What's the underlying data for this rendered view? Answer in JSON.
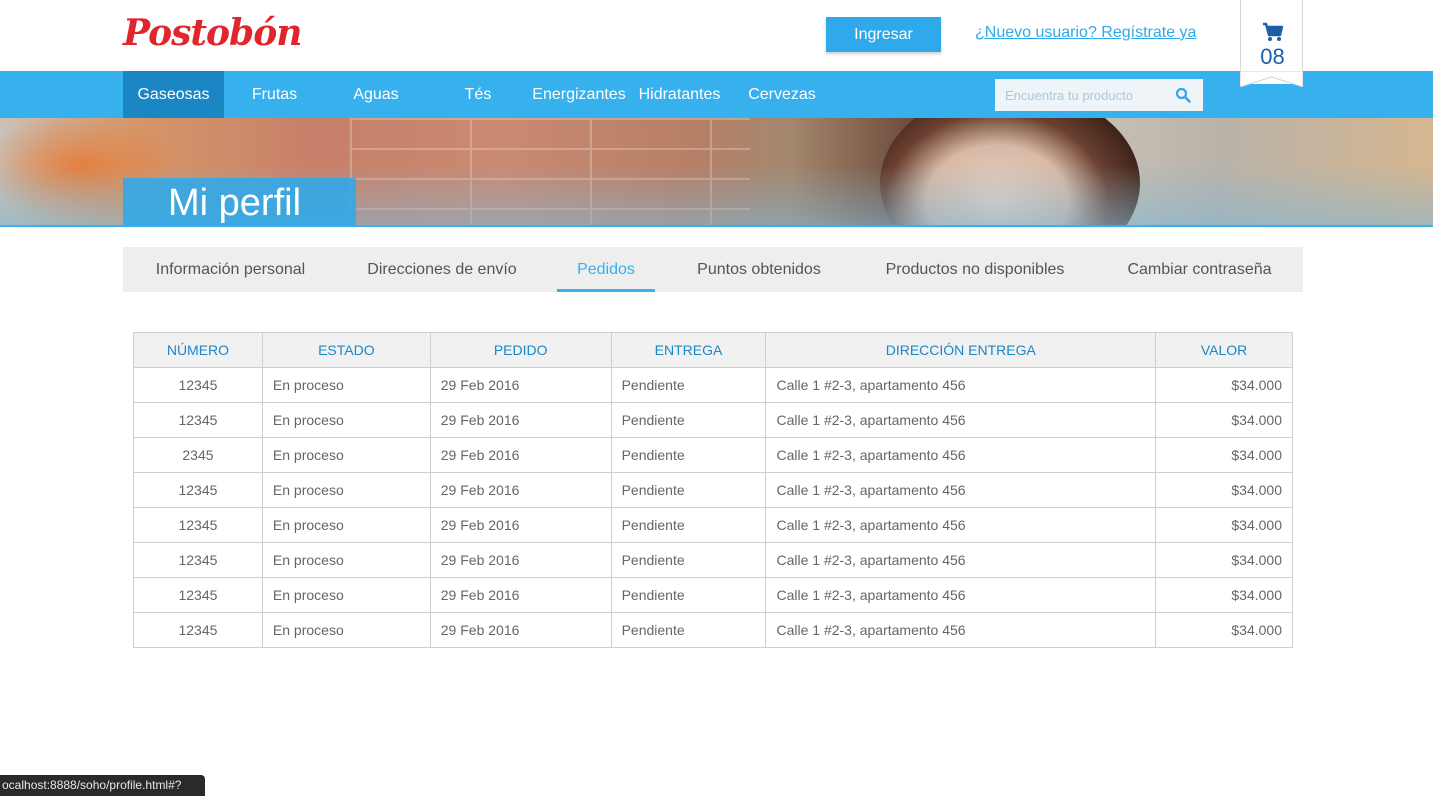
{
  "header": {
    "logo_text": "Postobón",
    "login_label": "Ingresar",
    "register_label": "¿Nuevo usuario? Regístrate ya",
    "cart_count": "08"
  },
  "nav": {
    "items": [
      {
        "label": "Gaseosas"
      },
      {
        "label": "Frutas"
      },
      {
        "label": "Aguas"
      },
      {
        "label": "Tés"
      },
      {
        "label": "Energizantes"
      },
      {
        "label": "Hidratantes"
      },
      {
        "label": "Cervezas"
      }
    ],
    "active_index": 0,
    "search_placeholder": "Encuentra tu producto"
  },
  "banner": {
    "title": "Mi perfil"
  },
  "tabs": {
    "items": [
      {
        "label": "Información personal"
      },
      {
        "label": "Direcciones de envío"
      },
      {
        "label": "Pedidos"
      },
      {
        "label": "Puntos obtenidos"
      },
      {
        "label": "Productos no disponibles"
      },
      {
        "label": "Cambiar contraseña"
      }
    ],
    "active_index": 2
  },
  "orders": {
    "columns": [
      "NÚMERO",
      "ESTADO",
      "PEDIDO",
      "ENTREGA",
      "DIRECCIÓN ENTREGA",
      "VALOR"
    ],
    "rows": [
      [
        "12345",
        "En proceso",
        "29 Feb 2016",
        "Pendiente",
        "Calle 1 #2-3, apartamento 456",
        "$34.000"
      ],
      [
        "12345",
        "En proceso",
        "29 Feb 2016",
        "Pendiente",
        "Calle 1 #2-3, apartamento 456",
        "$34.000"
      ],
      [
        "2345",
        "En proceso",
        "29 Feb 2016",
        "Pendiente",
        "Calle 1 #2-3, apartamento 456",
        "$34.000"
      ],
      [
        "12345",
        "En proceso",
        "29 Feb 2016",
        "Pendiente",
        "Calle 1 #2-3, apartamento 456",
        "$34.000"
      ],
      [
        "12345",
        "En proceso",
        "29 Feb 2016",
        "Pendiente",
        "Calle 1 #2-3, apartamento 456",
        "$34.000"
      ],
      [
        "12345",
        "En proceso",
        "29 Feb 2016",
        "Pendiente",
        "Calle 1 #2-3, apartamento 456",
        "$34.000"
      ],
      [
        "12345",
        "En proceso",
        "29 Feb 2016",
        "Pendiente",
        "Calle 1 #2-3, apartamento 456",
        "$34.000"
      ],
      [
        "12345",
        "En proceso",
        "29 Feb 2016",
        "Pendiente",
        "Calle 1 #2-3, apartamento 456",
        "$34.000"
      ]
    ]
  },
  "statusbar": {
    "url": "ocalhost:8888/soho/profile.html#?"
  },
  "colors": {
    "brand_red": "#e1252c",
    "accent_blue": "#37b0ee",
    "nav_active": "#1b86c4",
    "cart_blue": "#1b5fa8"
  },
  "icons": {
    "cart": "shopping-cart-icon",
    "search": "search-icon"
  }
}
